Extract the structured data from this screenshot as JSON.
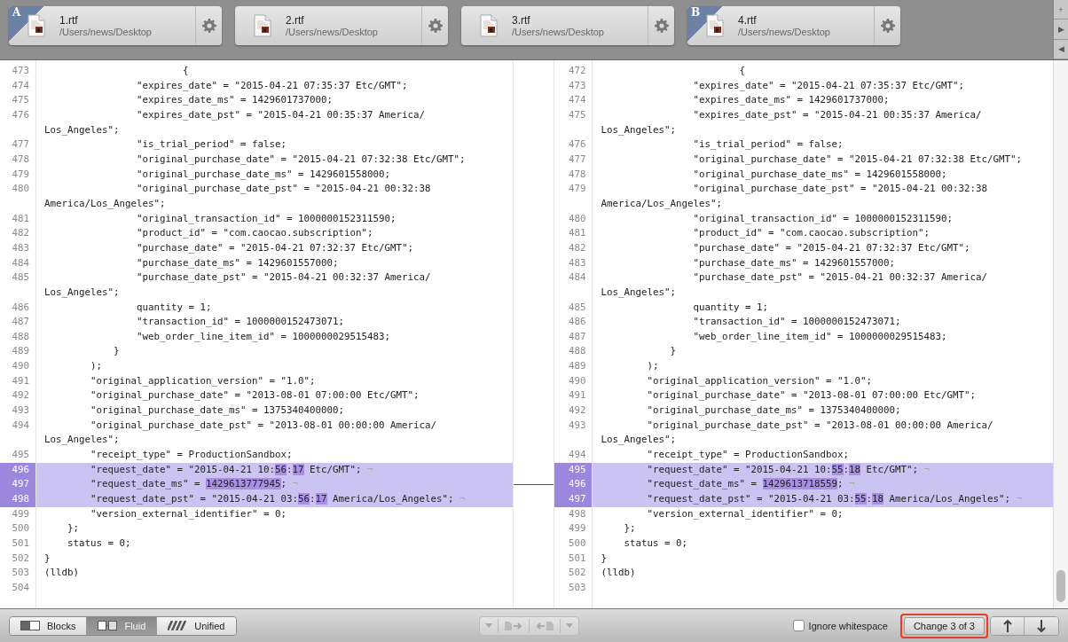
{
  "file_tabs": [
    {
      "name": "1.rtf",
      "path": "/Users/news/Desktop",
      "badge": "A"
    },
    {
      "name": "2.rtf",
      "path": "/Users/news/Desktop"
    },
    {
      "name": "3.rtf",
      "path": "/Users/news/Desktop"
    },
    {
      "name": "4.rtf",
      "path": "/Users/news/Desktop",
      "badge": "B"
    }
  ],
  "side_buttons": [
    "+",
    "▶",
    "◀"
  ],
  "panes": [
    {
      "lines": [
        {
          "num": "473",
          "changed": false,
          "text": "                        {"
        },
        {
          "num": "474",
          "changed": false,
          "text": "                \"expires_date\" = \"2015-04-21 07:35:37 Etc/GMT\";"
        },
        {
          "num": "475",
          "changed": false,
          "text": "                \"expires_date_ms\" = 1429601737000;"
        },
        {
          "num": "476",
          "changed": false,
          "text": "                \"expires_date_pst\" = \"2015-04-21 00:35:37 America/",
          "wrap": "Los_Angeles\";"
        },
        {
          "num": "477",
          "changed": false,
          "text": "                \"is_trial_period\" = false;"
        },
        {
          "num": "478",
          "changed": false,
          "text": "                \"original_purchase_date\" = \"2015-04-21 07:32:38 Etc/GMT\";"
        },
        {
          "num": "479",
          "changed": false,
          "text": "                \"original_purchase_date_ms\" = 1429601558000;"
        },
        {
          "num": "480",
          "changed": false,
          "text": "                \"original_purchase_date_pst\" = \"2015-04-21 00:32:38",
          "wrap": "America/Los_Angeles\";"
        },
        {
          "num": "481",
          "changed": false,
          "text": "                \"original_transaction_id\" = 1000000152311590;"
        },
        {
          "num": "482",
          "changed": false,
          "text": "                \"product_id\" = \"com.caocao.subscription\";"
        },
        {
          "num": "483",
          "changed": false,
          "text": "                \"purchase_date\" = \"2015-04-21 07:32:37 Etc/GMT\";"
        },
        {
          "num": "484",
          "changed": false,
          "text": "                \"purchase_date_ms\" = 1429601557000;"
        },
        {
          "num": "485",
          "changed": false,
          "text": "                \"purchase_date_pst\" = \"2015-04-21 00:32:37 America/",
          "wrap": "Los_Angeles\";"
        },
        {
          "num": "486",
          "changed": false,
          "text": "                quantity = 1;"
        },
        {
          "num": "487",
          "changed": false,
          "text": "                \"transaction_id\" = 1000000152473071;"
        },
        {
          "num": "488",
          "changed": false,
          "text": "                \"web_order_line_item_id\" = 1000000029515483;"
        },
        {
          "num": "489",
          "changed": false,
          "text": "            }"
        },
        {
          "num": "490",
          "changed": false,
          "text": "        );"
        },
        {
          "num": "491",
          "changed": false,
          "text": "        \"original_application_version\" = \"1.0\";"
        },
        {
          "num": "492",
          "changed": false,
          "text": "        \"original_purchase_date\" = \"2013-08-01 07:00:00 Etc/GMT\";"
        },
        {
          "num": "493",
          "changed": false,
          "text": "        \"original_purchase_date_ms\" = 1375340400000;"
        },
        {
          "num": "494",
          "changed": false,
          "text": "        \"original_purchase_date_pst\" = \"2013-08-01 00:00:00 America/",
          "wrap": "Los_Angeles\";"
        },
        {
          "num": "495",
          "changed": false,
          "text": "        \"receipt_type\" = ProductionSandbox;"
        },
        {
          "num": "496",
          "changed": true,
          "eol": "¬",
          "parts": [
            {
              "text": "        \"request_date\" = \"2015-04-21 10:",
              "changed": false
            },
            {
              "text": "56",
              "changed": true
            },
            {
              "text": ":",
              "changed": false
            },
            {
              "text": "17",
              "changed": true
            },
            {
              "text": " Etc/GMT\";",
              "changed": false
            }
          ]
        },
        {
          "num": "497",
          "changed": true,
          "eol": "¬",
          "parts": [
            {
              "text": "        \"request_date_ms\" = ",
              "changed": false
            },
            {
              "text": "1429613777945",
              "changed": true
            },
            {
              "text": ";",
              "changed": false
            }
          ]
        },
        {
          "num": "498",
          "changed": true,
          "eol": "¬",
          "parts": [
            {
              "text": "        \"request_date_pst\" = \"2015-04-21 03:",
              "changed": false
            },
            {
              "text": "56",
              "changed": true
            },
            {
              "text": ":",
              "changed": false
            },
            {
              "text": "17",
              "changed": true
            },
            {
              "text": " America/Los_Angeles\";",
              "changed": false
            }
          ]
        },
        {
          "num": "499",
          "changed": false,
          "text": "        \"version_external_identifier\" = 0;"
        },
        {
          "num": "500",
          "changed": false,
          "text": "    };"
        },
        {
          "num": "501",
          "changed": false,
          "text": "    status = 0;"
        },
        {
          "num": "502",
          "changed": false,
          "text": "}"
        },
        {
          "num": "503",
          "changed": false,
          "text": "(lldb)"
        },
        {
          "num": "504",
          "changed": false
        }
      ]
    },
    {
      "lines": [
        {
          "num": "472",
          "changed": false,
          "text": "                        {"
        },
        {
          "num": "473",
          "changed": false,
          "text": "                \"expires_date\" = \"2015-04-21 07:35:37 Etc/GMT\";"
        },
        {
          "num": "474",
          "changed": false,
          "text": "                \"expires_date_ms\" = 1429601737000;"
        },
        {
          "num": "475",
          "changed": false,
          "text": "                \"expires_date_pst\" = \"2015-04-21 00:35:37 America/",
          "wrap": "Los_Angeles\";"
        },
        {
          "num": "476",
          "changed": false,
          "text": "                \"is_trial_period\" = false;"
        },
        {
          "num": "477",
          "changed": false,
          "text": "                \"original_purchase_date\" = \"2015-04-21 07:32:38 Etc/GMT\";"
        },
        {
          "num": "478",
          "changed": false,
          "text": "                \"original_purchase_date_ms\" = 1429601558000;"
        },
        {
          "num": "479",
          "changed": false,
          "text": "                \"original_purchase_date_pst\" = \"2015-04-21 00:32:38",
          "wrap": "America/Los_Angeles\";"
        },
        {
          "num": "480",
          "changed": false,
          "text": "                \"original_transaction_id\" = 1000000152311590;"
        },
        {
          "num": "481",
          "changed": false,
          "text": "                \"product_id\" = \"com.caocao.subscription\";"
        },
        {
          "num": "482",
          "changed": false,
          "text": "                \"purchase_date\" = \"2015-04-21 07:32:37 Etc/GMT\";"
        },
        {
          "num": "483",
          "changed": false,
          "text": "                \"purchase_date_ms\" = 1429601557000;"
        },
        {
          "num": "484",
          "changed": false,
          "text": "                \"purchase_date_pst\" = \"2015-04-21 00:32:37 America/",
          "wrap": "Los_Angeles\";"
        },
        {
          "num": "485",
          "changed": false,
          "text": "                quantity = 1;"
        },
        {
          "num": "486",
          "changed": false,
          "text": "                \"transaction_id\" = 1000000152473071;"
        },
        {
          "num": "487",
          "changed": false,
          "text": "                \"web_order_line_item_id\" = 1000000029515483;"
        },
        {
          "num": "488",
          "changed": false,
          "text": "            }"
        },
        {
          "num": "489",
          "changed": false,
          "text": "        );"
        },
        {
          "num": "490",
          "changed": false,
          "text": "        \"original_application_version\" = \"1.0\";"
        },
        {
          "num": "491",
          "changed": false,
          "text": "        \"original_purchase_date\" = \"2013-08-01 07:00:00 Etc/GMT\";"
        },
        {
          "num": "492",
          "changed": false,
          "text": "        \"original_purchase_date_ms\" = 1375340400000;"
        },
        {
          "num": "493",
          "changed": false,
          "text": "        \"original_purchase_date_pst\" = \"2013-08-01 00:00:00 America/",
          "wrap": "Los_Angeles\";"
        },
        {
          "num": "494",
          "changed": false,
          "text": "        \"receipt_type\" = ProductionSandbox;"
        },
        {
          "num": "495",
          "changed": true,
          "eol": "¬",
          "parts": [
            {
              "text": "        \"request_date\" = \"2015-04-21 10:",
              "changed": false
            },
            {
              "text": "55",
              "changed": true
            },
            {
              "text": ":",
              "changed": false
            },
            {
              "text": "18",
              "changed": true
            },
            {
              "text": " Etc/GMT\";",
              "changed": false
            }
          ]
        },
        {
          "num": "496",
          "changed": true,
          "eol": "¬",
          "parts": [
            {
              "text": "        \"request_date_ms\" = ",
              "changed": false
            },
            {
              "text": "1429613718559",
              "changed": true
            },
            {
              "text": ";",
              "changed": false
            }
          ]
        },
        {
          "num": "497",
          "changed": true,
          "eol": "¬",
          "parts": [
            {
              "text": "        \"request_date_pst\" = \"2015-04-21 03:",
              "changed": false
            },
            {
              "text": "55",
              "changed": true
            },
            {
              "text": ":",
              "changed": false
            },
            {
              "text": "18",
              "changed": true
            },
            {
              "text": " America/Los_Angeles\";",
              "changed": false
            }
          ]
        },
        {
          "num": "498",
          "changed": false,
          "text": "        \"version_external_identifier\" = 0;"
        },
        {
          "num": "499",
          "changed": false,
          "text": "    };"
        },
        {
          "num": "500",
          "changed": false,
          "text": "    status = 0;"
        },
        {
          "num": "501",
          "changed": false,
          "text": "}"
        },
        {
          "num": "502",
          "changed": false,
          "text": "(lldb)"
        },
        {
          "num": "503",
          "changed": false
        }
      ]
    }
  ],
  "toolbar": {
    "view_modes": [
      {
        "label": "Blocks",
        "kind": "blocks",
        "selected": false
      },
      {
        "label": "Fluid",
        "kind": "fluid",
        "selected": true
      },
      {
        "label": "Unified",
        "kind": "unified",
        "selected": false
      }
    ],
    "ignore_whitespace": {
      "label": "Ignore whitespace",
      "checked": false
    },
    "change_counter": {
      "label": "Change 3 of 3",
      "highlighted": true
    }
  }
}
